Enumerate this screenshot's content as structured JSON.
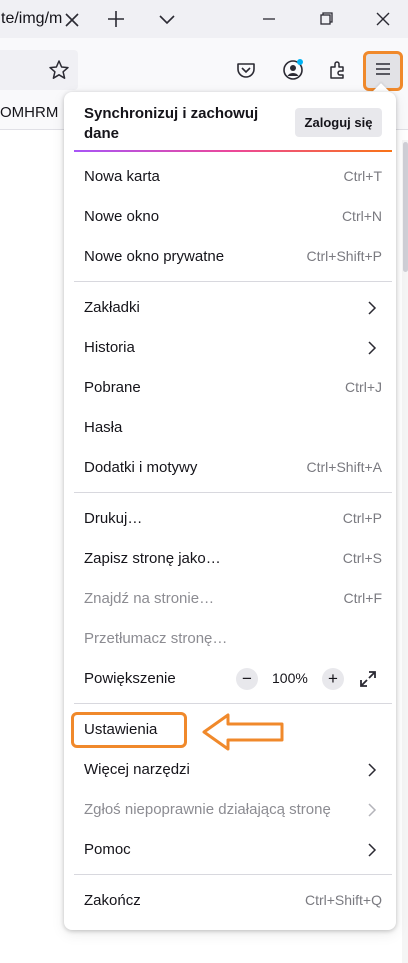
{
  "tab": {
    "title": "te/img/m"
  },
  "bookmarks": {
    "item": "OMHRM"
  },
  "sync": {
    "title": "Synchronizuj i zachowuj dane",
    "button": "Zaloguj się"
  },
  "group1": [
    {
      "label": "Nowa karta",
      "shortcut": "Ctrl+T"
    },
    {
      "label": "Nowe okno",
      "shortcut": "Ctrl+N"
    },
    {
      "label": "Nowe okno prywatne",
      "shortcut": "Ctrl+Shift+P"
    }
  ],
  "group2": [
    {
      "label": "Zakładki",
      "shortcut": ""
    },
    {
      "label": "Historia",
      "shortcut": ""
    },
    {
      "label": "Pobrane",
      "shortcut": "Ctrl+J"
    },
    {
      "label": "Hasła",
      "shortcut": ""
    },
    {
      "label": "Dodatki i motywy",
      "shortcut": "Ctrl+Shift+A"
    }
  ],
  "group3": [
    {
      "label": "Drukuj…",
      "shortcut": "Ctrl+P"
    },
    {
      "label": "Zapisz stronę jako…",
      "shortcut": "Ctrl+S"
    },
    {
      "label": "Znajdź na stronie…",
      "shortcut": "Ctrl+F"
    },
    {
      "label": "Przetłumacz stronę…",
      "shortcut": ""
    }
  ],
  "zoom": {
    "label": "Powiększenie",
    "minus": "−",
    "value": "100%",
    "plus": "+"
  },
  "group4": [
    {
      "label": "Ustawienia",
      "shortcut": ""
    },
    {
      "label": "Więcej narzędzi",
      "shortcut": ""
    },
    {
      "label": "Zgłoś niepoprawnie działającą stronę",
      "shortcut": ""
    },
    {
      "label": "Pomoc",
      "shortcut": ""
    }
  ],
  "quit": {
    "label": "Zakończ",
    "shortcut": "Ctrl+Shift+Q"
  },
  "colors": {
    "highlight": "#f0892b",
    "notification_dot": "#00b3f4",
    "sync_gradient": [
      "#a855f7",
      "#ec4899",
      "#f97316"
    ]
  },
  "icons": [
    "close-icon",
    "plus-icon",
    "chevron-down-icon",
    "minimize-icon",
    "restore-icon",
    "star-icon",
    "pocket-icon",
    "account-icon",
    "extensions-icon",
    "hamburger-icon",
    "chevron-right-icon",
    "fullscreen-icon",
    "arrow-left-icon"
  ]
}
